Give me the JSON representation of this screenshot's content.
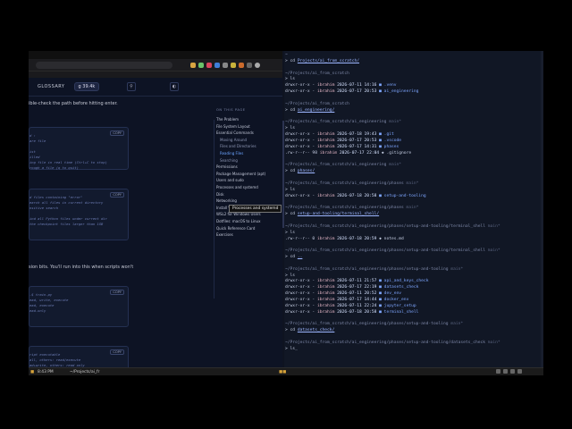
{
  "browser": {
    "site": {
      "glossary_label": "GLOSSARY",
      "github_label": "g 39.4k"
    },
    "content": {
      "intro_text": "ible-check the path before hitting enter.",
      "mid_text": "sion bits. You'll run into this when scripts won't",
      "copy_label": "COPY",
      "blocks": [
        [
          "d  :",
          "are file",
          "",
          "ist",
          "illed",
          "ing file in real time (Ctrl+C to stop)",
          "rough a file (q to quit)"
        ],
        [
          "d files containing \"error\"",
          "earch all files in current directory",
          "nsitive search",
          "",
          "ind all Python files under current dir",
          "the checkpoint files larger than 1GB"
        ],
        [
          "-$ train.py",
          "ead, write, execute",
          "ead, execute",
          "ead-only"
        ],
        [
          "ript executable",
          "all, others: read/execute",
          "ad+write, others: read only"
        ]
      ]
    },
    "toc": {
      "heading": "ON THIS PAGE",
      "items": [
        {
          "label": "The Problem",
          "sub": false,
          "active": false
        },
        {
          "label": "File System Layout",
          "sub": false,
          "active": false
        },
        {
          "label": "Essential Commands",
          "sub": false,
          "active": false
        },
        {
          "label": "Moving Around",
          "sub": true,
          "active": false
        },
        {
          "label": "Files and Directories",
          "sub": true,
          "active": false
        },
        {
          "label": "Reading Files",
          "sub": true,
          "active": true
        },
        {
          "label": "Searching",
          "sub": true,
          "active": false
        },
        {
          "label": "Permissions",
          "sub": false,
          "active": false
        },
        {
          "label": "Package Management (apt)",
          "sub": false,
          "active": false
        },
        {
          "label": "Users and sudo",
          "sub": false,
          "active": false
        },
        {
          "label": "Processes and systemd",
          "sub": false,
          "active": false
        },
        {
          "label": "Disk",
          "sub": false,
          "active": false
        },
        {
          "label": "Networking",
          "sub": false,
          "active": false
        },
        {
          "label": "Install Warp terminal Alias",
          "sub": false,
          "active": false
        },
        {
          "label": "WSL2 for Windows Users",
          "sub": false,
          "active": false
        },
        {
          "label": "Dotfiles: macOS to Linux",
          "sub": false,
          "active": false
        },
        {
          "label": "Quick Reference Card",
          "sub": false,
          "active": false
        },
        {
          "label": "Exercises",
          "sub": false,
          "active": false
        }
      ],
      "tooltip": "Processes and systemd"
    }
  },
  "terminal": {
    "lines": [
      {
        "seg": [
          [
            "~",
            "c-path"
          ]
        ]
      },
      {
        "seg": [
          [
            "> cd ",
            "c-cmd"
          ],
          [
            "Projects/ai_from_scratch/",
            "c-link"
          ]
        ]
      },
      {
        "seg": []
      },
      {
        "seg": [
          [
            "~/Projects/ai_from_scratch",
            "c-path"
          ]
        ]
      },
      {
        "seg": [
          [
            "> ls",
            "c-cmd"
          ]
        ]
      },
      {
        "seg": [
          [
            "drwxr-xr-x - ",
            "c-cmd"
          ],
          [
            "ibrahim",
            "c-user"
          ],
          [
            " 2026-07-11 14:16 ",
            "c-date"
          ],
          [
            "■ .venv",
            "c-dir"
          ]
        ]
      },
      {
        "seg": [
          [
            "drwxr-xr-x - ",
            "c-cmd"
          ],
          [
            "ibrahim",
            "c-user"
          ],
          [
            " 2026-07-17 20:53 ",
            "c-date"
          ],
          [
            "■ ai_engineering",
            "c-dir"
          ]
        ]
      },
      {
        "seg": []
      },
      {
        "seg": [
          [
            "~/Projects/ai_from_scratch",
            "c-path"
          ]
        ]
      },
      {
        "seg": [
          [
            "> cd ",
            "c-cmd"
          ],
          [
            "ai_engineering/",
            "c-link"
          ]
        ]
      },
      {
        "seg": []
      },
      {
        "seg": [
          [
            "~/Projects/ai_from_scratch/ai_engineering ",
            "c-path"
          ],
          [
            "main*",
            "c-main"
          ]
        ]
      },
      {
        "seg": [
          [
            "> ls",
            "c-cmd"
          ]
        ]
      },
      {
        "seg": [
          [
            "drwxr-xr-x - ",
            "c-cmd"
          ],
          [
            "ibrahim",
            "c-user"
          ],
          [
            " 2026-07-18 19:43 ",
            "c-date"
          ],
          [
            "■ .git",
            "c-dir"
          ]
        ]
      },
      {
        "seg": [
          [
            "drwxr-xr-x - ",
            "c-cmd"
          ],
          [
            "ibrahim",
            "c-user"
          ],
          [
            " 2026-07-17 20:53 ",
            "c-date"
          ],
          [
            "■ .vscode",
            "c-dir"
          ]
        ]
      },
      {
        "seg": [
          [
            "drwxr-xr-x - ",
            "c-cmd"
          ],
          [
            "ibrahim",
            "c-user"
          ],
          [
            " 2026-07-17 14:31 ",
            "c-date"
          ],
          [
            "■ phases",
            "c-dir"
          ]
        ]
      },
      {
        "seg": [
          [
            ".rw-r--r-- 98 ",
            "c-cmd"
          ],
          [
            "ibrahim",
            "c-user"
          ],
          [
            " 2026-07-17 22:04 ",
            "c-date"
          ],
          [
            "◆ .gitignore",
            "c-cmd"
          ]
        ]
      },
      {
        "seg": []
      },
      {
        "seg": [
          [
            "~/Projects/ai_from_scratch/ai_engineering ",
            "c-path"
          ],
          [
            "main*",
            "c-main"
          ]
        ]
      },
      {
        "seg": [
          [
            "> cd ",
            "c-cmd"
          ],
          [
            "phases/",
            "c-link"
          ]
        ]
      },
      {
        "seg": []
      },
      {
        "seg": [
          [
            "~/Projects/ai_from_scratch/ai_engineering/phases ",
            "c-path"
          ],
          [
            "main*",
            "c-main"
          ]
        ]
      },
      {
        "seg": [
          [
            "> ls",
            "c-cmd"
          ]
        ]
      },
      {
        "seg": [
          [
            "drwxr-xr-x - ",
            "c-cmd"
          ],
          [
            "ibrahim",
            "c-user"
          ],
          [
            " 2026-07-18 20:58 ",
            "c-date"
          ],
          [
            "■ setup-and-tooling",
            "c-dir"
          ]
        ]
      },
      {
        "seg": []
      },
      {
        "seg": [
          [
            "~/Projects/ai_from_scratch/ai_engineering/phases ",
            "c-path"
          ],
          [
            "main*",
            "c-main"
          ]
        ]
      },
      {
        "seg": [
          [
            "> cd ",
            "c-cmd"
          ],
          [
            "setup-and-tooling/terminal_shell/",
            "c-link"
          ]
        ]
      },
      {
        "seg": []
      },
      {
        "seg": [
          [
            "~/Projects/ai_from_scratch/ai_engineering/phases/setup-and-tooling/terminal_shell ",
            "c-path"
          ],
          [
            "main*",
            "c-main"
          ]
        ]
      },
      {
        "seg": [
          [
            "> ls",
            "c-cmd"
          ]
        ]
      },
      {
        "seg": [
          [
            ".rw-r--r-- 0 ",
            "c-cmd"
          ],
          [
            "ibrahim",
            "c-user"
          ],
          [
            " 2026-07-18 20:59 ",
            "c-date"
          ],
          [
            "◆ notes.md",
            "c-cmd"
          ]
        ]
      },
      {
        "seg": []
      },
      {
        "seg": [
          [
            "~/Projects/ai_from_scratch/ai_engineering/phases/setup-and-tooling/terminal_shell ",
            "c-path"
          ],
          [
            "main*",
            "c-main"
          ]
        ]
      },
      {
        "seg": [
          [
            "> cd ",
            "c-cmd"
          ],
          [
            "..",
            "c-link"
          ]
        ]
      },
      {
        "seg": []
      },
      {
        "seg": [
          [
            "~/Projects/ai_from_scratch/ai_engineering/phases/setup-and-tooling ",
            "c-path"
          ],
          [
            "main*",
            "c-main"
          ]
        ]
      },
      {
        "seg": [
          [
            "> ls",
            "c-cmd"
          ]
        ]
      },
      {
        "seg": [
          [
            "drwxr-xr-x - ",
            "c-cmd"
          ],
          [
            "ibrahim",
            "c-user"
          ],
          [
            " 2026-07-11 21:57 ",
            "c-date"
          ],
          [
            "■ api_and_keys_check",
            "c-dir"
          ]
        ]
      },
      {
        "seg": [
          [
            "drwxr-xr-x - ",
            "c-cmd"
          ],
          [
            "ibrahim",
            "c-user"
          ],
          [
            " 2026-07-17 22:19 ",
            "c-date"
          ],
          [
            "■ datasets_check",
            "c-dir"
          ]
        ]
      },
      {
        "seg": [
          [
            "drwxr-xr-x - ",
            "c-cmd"
          ],
          [
            "ibrahim",
            "c-user"
          ],
          [
            " 2026-07-11 20:52 ",
            "c-date"
          ],
          [
            "■ dev_env",
            "c-dir"
          ]
        ]
      },
      {
        "seg": [
          [
            "drwxr-xr-x - ",
            "c-cmd"
          ],
          [
            "ibrahim",
            "c-user"
          ],
          [
            " 2026-07-17 14:44 ",
            "c-date"
          ],
          [
            "■ docker_env",
            "c-dir"
          ]
        ]
      },
      {
        "seg": [
          [
            "drwxr-xr-x - ",
            "c-cmd"
          ],
          [
            "ibrahim",
            "c-user"
          ],
          [
            " 2026-07-11 22:24 ",
            "c-date"
          ],
          [
            "■ jupyter_setup",
            "c-dir"
          ]
        ]
      },
      {
        "seg": [
          [
            "drwxr-xr-x - ",
            "c-cmd"
          ],
          [
            "ibrahim",
            "c-user"
          ],
          [
            " 2026-07-18 20:58 ",
            "c-date"
          ],
          [
            "■ terminal_shell",
            "c-dir"
          ]
        ]
      },
      {
        "seg": []
      },
      {
        "seg": [
          [
            "~/Projects/ai_from_scratch/ai_engineering/phases/setup-and-tooling ",
            "c-path"
          ],
          [
            "main*",
            "c-main"
          ]
        ]
      },
      {
        "seg": [
          [
            "> cd ",
            "c-cmd"
          ],
          [
            "datasets_check/",
            "c-link"
          ]
        ]
      },
      {
        "seg": []
      },
      {
        "seg": [
          [
            "~/Projects/ai_from_scratch/ai_engineering/phases/setup-and-tooling/datasets_check ",
            "c-path"
          ],
          [
            "main*",
            "c-main"
          ]
        ]
      },
      {
        "seg": [
          [
            "> ls_",
            "c-cmd"
          ]
        ]
      }
    ]
  },
  "taskbar": {
    "time": "8:43 PM",
    "window_title": "~/Projects/ai_fr"
  }
}
